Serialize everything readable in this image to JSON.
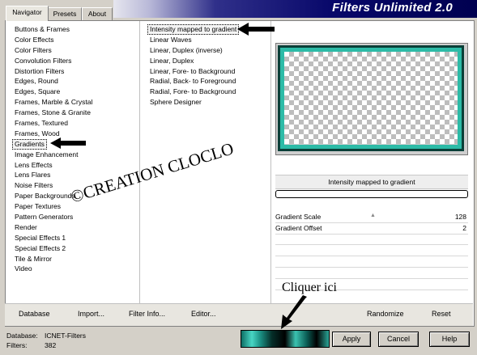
{
  "app": {
    "title": "Filters Unlimited 2.0"
  },
  "tabs": [
    {
      "label": "Navigator",
      "active": true
    },
    {
      "label": "Presets",
      "active": false
    },
    {
      "label": "About",
      "active": false
    }
  ],
  "categories": [
    "Buttons & Frames",
    "Color Effects",
    "Color Filters",
    "Convolution Filters",
    "Distortion Filters",
    "Edges, Round",
    "Edges, Square",
    "Frames, Marble & Crystal",
    "Frames, Stone & Granite",
    "Frames, Textured",
    "Frames, Wood",
    "Gradients",
    "Image Enhancement",
    "Lens Effects",
    "Lens Flares",
    "Noise Filters",
    "Paper Backgrounds",
    "Paper Textures",
    "Pattern Generators",
    "Render",
    "Special Effects 1",
    "Special Effects 2",
    "Tile & Mirror",
    "Video"
  ],
  "selected_category": "Gradients",
  "filters": [
    "Intensity mapped to gradient",
    "Linear Waves",
    "Linear, Duplex (inverse)",
    "Linear, Duplex",
    "Linear, Fore- to Background",
    "Radial, Back- to Foreground",
    "Radial, Fore- to Background",
    "Sphere Designer"
  ],
  "selected_filter": "Intensity mapped to gradient",
  "filter_name_display": "Intensity mapped to gradient",
  "params": [
    {
      "label": "Gradient Scale",
      "value": "128"
    },
    {
      "label": "Gradient Offset",
      "value": "2"
    }
  ],
  "toolbar": {
    "database": "Database",
    "import": "Import...",
    "filter_info": "Filter Info...",
    "editor": "Editor...",
    "randomize": "Randomize",
    "reset": "Reset"
  },
  "status": {
    "database_label": "Database:",
    "database_value": "ICNET-Filters",
    "filters_label": "Filters:",
    "filters_value": "382"
  },
  "buttons": {
    "apply": "Apply",
    "cancel": "Cancel",
    "help": "Help"
  },
  "annotations": {
    "watermark": "©CREATION CLOCLO",
    "callout": "Cliquer ici"
  },
  "colors": {
    "accent_teal": "#2dbba7",
    "header_navy": "#08086a"
  }
}
